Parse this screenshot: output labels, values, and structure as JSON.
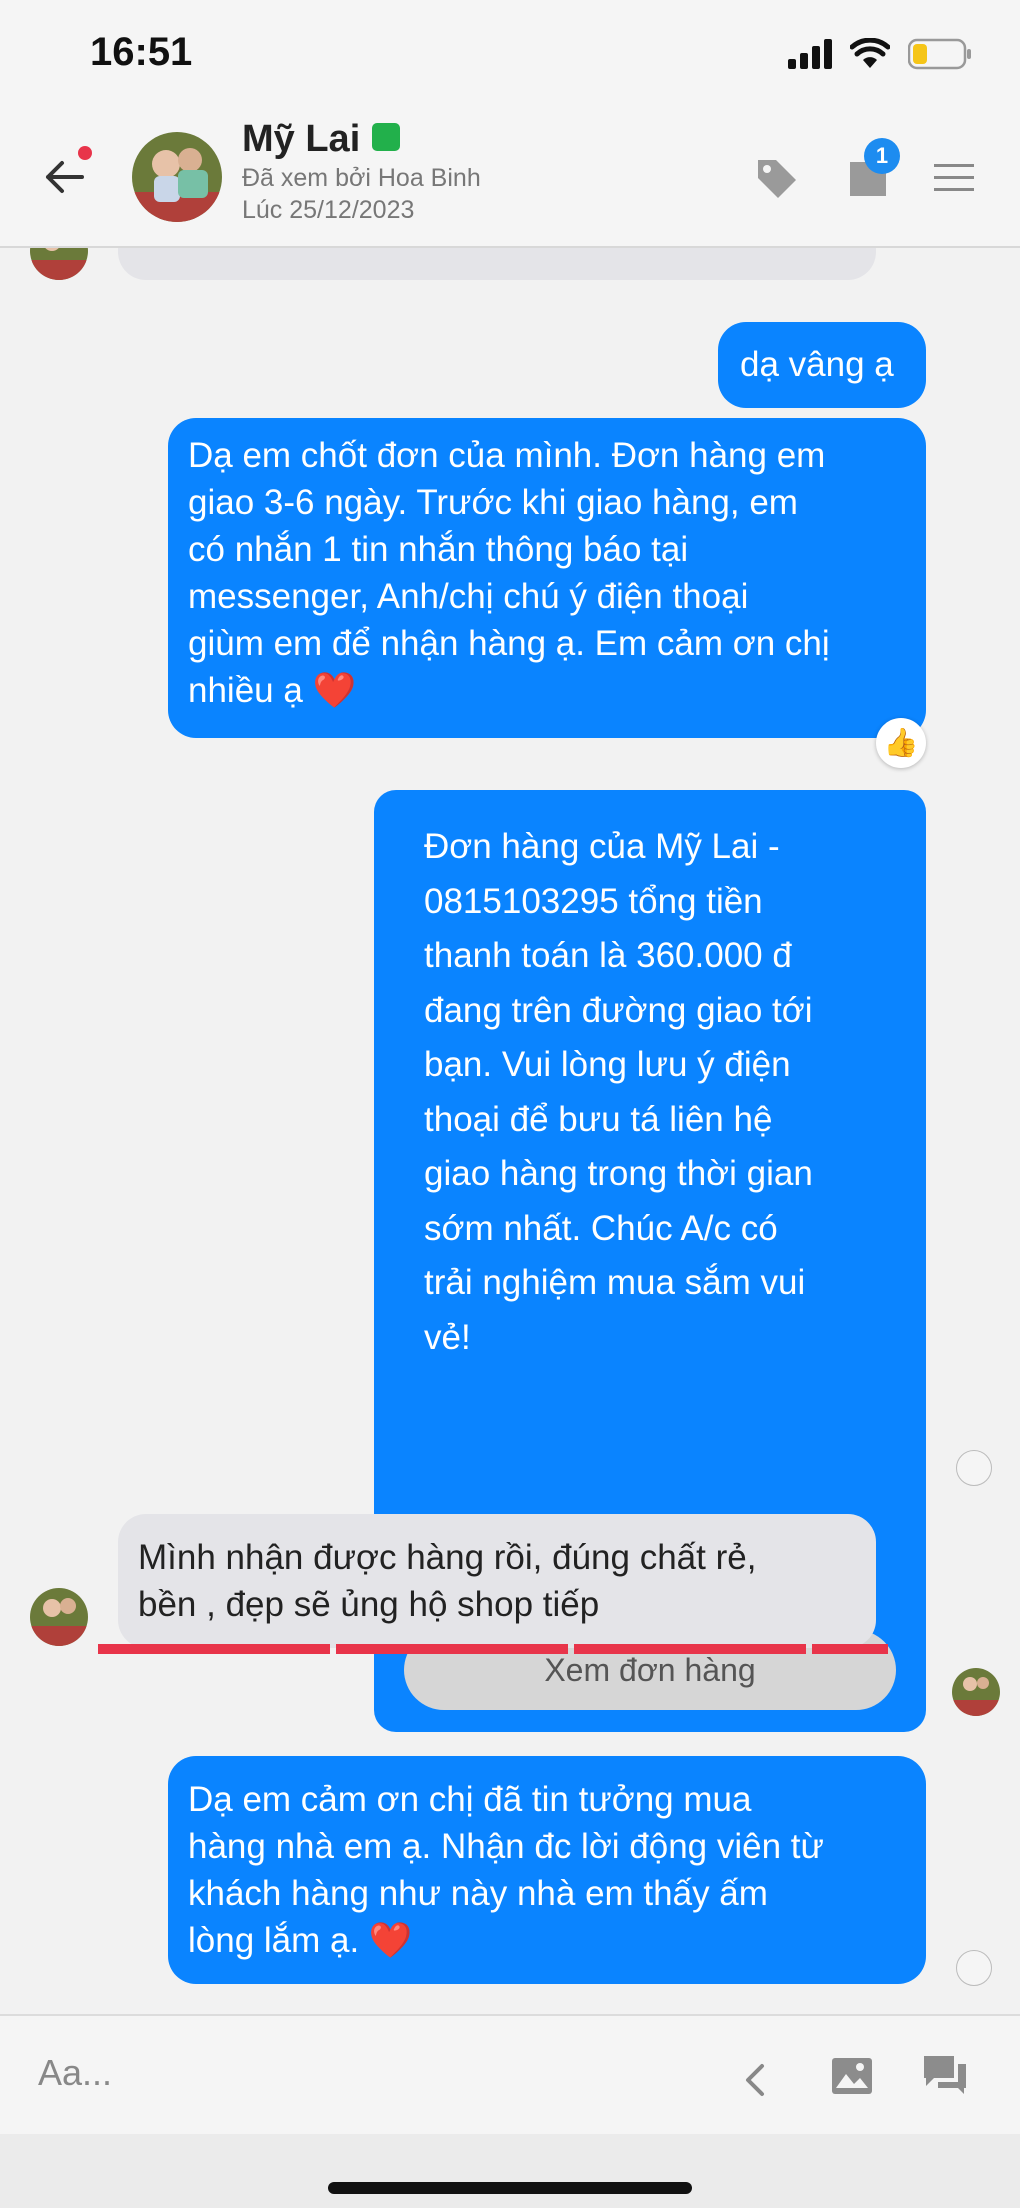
{
  "status_bar": {
    "time": "16:51"
  },
  "header": {
    "contact_name": "Mỹ Lai",
    "seen_by": "Đã xem bởi Hoa Binh",
    "seen_time": "Lúc 25/12/2023",
    "notes_badge_count": "1"
  },
  "messages": [
    {
      "id": "m1",
      "direction": "out",
      "text": "dạ vâng ạ"
    },
    {
      "id": "m2",
      "direction": "out",
      "lines": [
        "Dạ em chốt đơn của mình. Đơn hàng em",
        "giao 3-6 ngày. Trước khi giao hàng, em",
        "có nhắn 1 tin nhắn thông báo tại",
        "messenger, Anh/chị chú ý điện thoại",
        "giùm em để nhận hàng ạ. Em cảm ơn chị",
        "nhiều ạ ❤️"
      ],
      "reaction": "👍"
    },
    {
      "id": "m3",
      "direction": "out",
      "lines": [
        "Đơn hàng của Mỹ Lai -",
        "0815103295 tổng tiền",
        "thanh toán là 360.000 đ",
        "đang trên đường giao tới",
        "bạn. Vui lòng lưu ý điện",
        "thoại để bưu tá liên hệ",
        "giao hàng trong thời gian",
        "sớm nhất. Chúc A/c có",
        "trải nghiệm mua sắm vui",
        "vẻ!"
      ],
      "button_label": "Xem đơn hàng"
    },
    {
      "id": "m4",
      "direction": "in",
      "lines": [
        "Mình nhận được hàng rồi, đúng chất rẻ,",
        "bền , đẹp sẽ ủng hộ shop tiếp"
      ]
    },
    {
      "id": "m5",
      "direction": "out",
      "lines": [
        "Dạ em cảm ơn chị đã tin tưởng mua",
        "hàng nhà em ạ. Nhận đc lời động viên từ",
        "khách hàng như này nhà em thấy ấm",
        "lòng lắm ạ. ❤️"
      ]
    }
  ],
  "composer": {
    "placeholder": "Aa..."
  },
  "colors": {
    "outgoing_bubble": "#0a84ff",
    "incoming_bubble": "#e4e4e8",
    "highlight_underline": "#e8344a",
    "badge": "#1d8cf0",
    "phone_badge": "#22b04b"
  },
  "icons": [
    "back-arrow-icon",
    "tag-icon",
    "notes-icon",
    "menu-icon",
    "chevron-left-icon",
    "image-icon",
    "chat-bubbles-icon",
    "signal-icon",
    "wifi-icon",
    "battery-icon"
  ]
}
